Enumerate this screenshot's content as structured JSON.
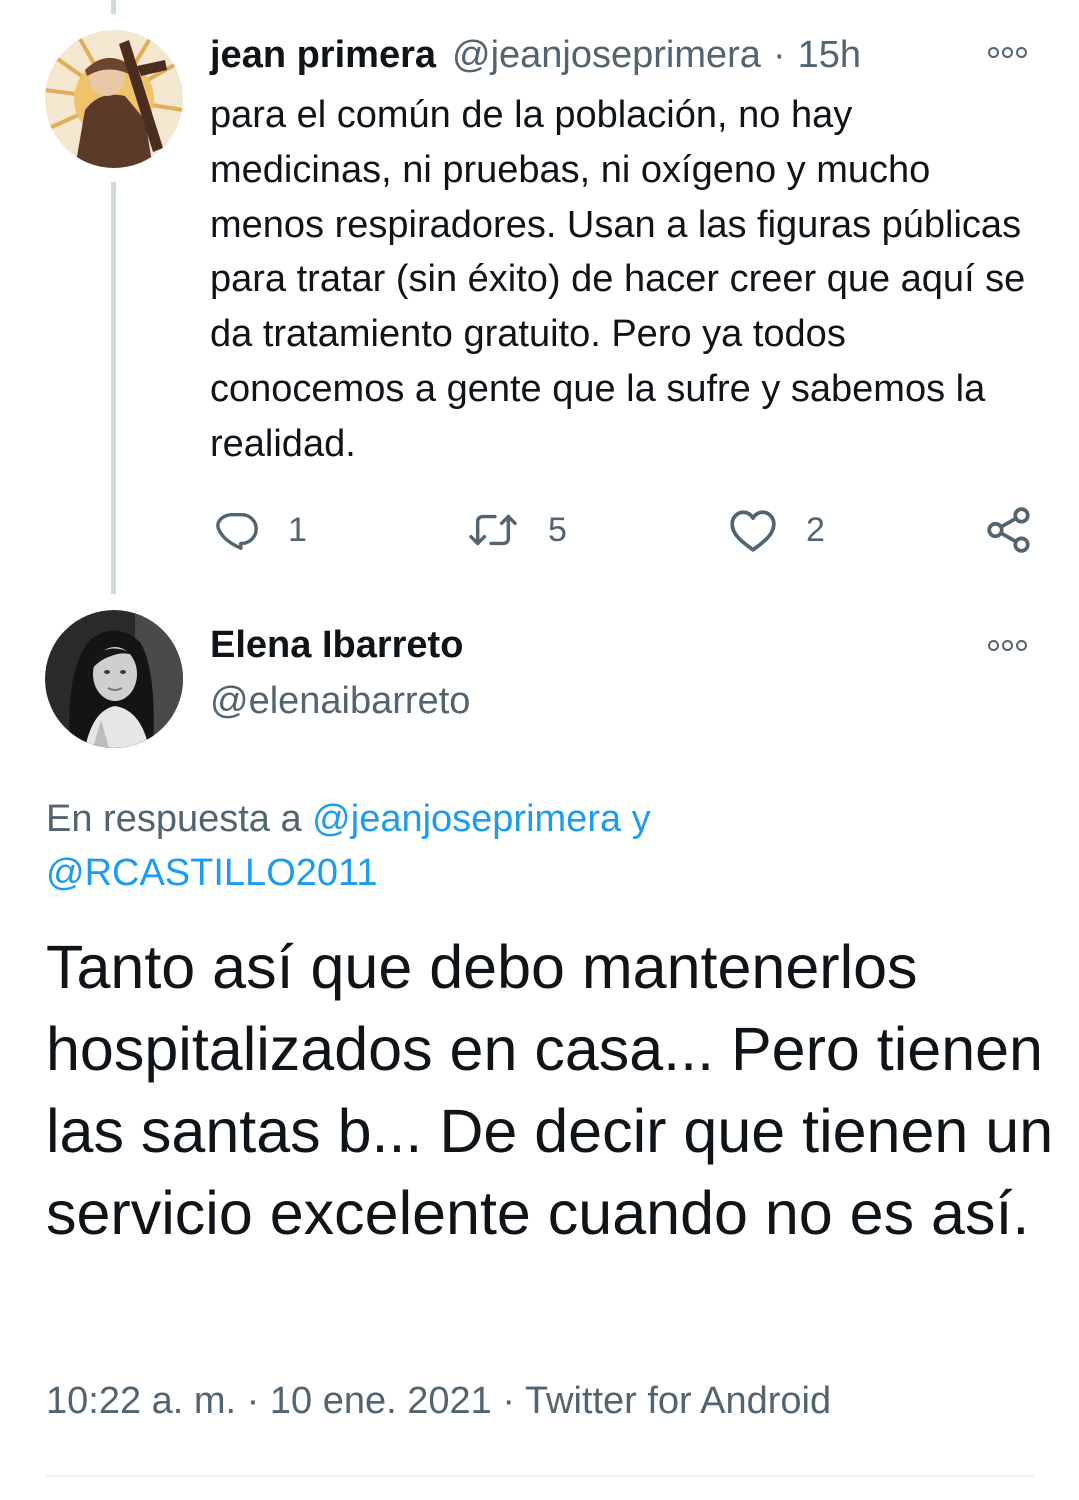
{
  "parent_tweet": {
    "display_name": "jean primera",
    "handle": "@jeanjoseprimera",
    "separator": "·",
    "time": "15h",
    "text": "para el común de la población, no hay medicinas, ni pruebas, ni oxígeno y mucho menos respiradores. Usan a las figuras públicas para tratar (sin éxito) de hacer creer que aquí se da tratamiento gratuito. Pero ya todos conocemos a gente que la sufre y sabemos la realidad.",
    "reply_count": "1",
    "retweet_count": "5",
    "like_count": "2",
    "icons": [
      "reply-icon",
      "retweet-icon",
      "like-icon",
      "share-icon",
      "more-icon"
    ]
  },
  "main_tweet": {
    "display_name": "Elena Ibarreto",
    "handle": "@elenaibarreto",
    "reply_prefix": "En respuesta a ",
    "mention_1": "@jeanjoseprimera",
    "conjunction": " y",
    "mention_2": "@RCASTILLO2011",
    "text": "Tanto así que debo mantenerlos hospitalizados en casa... Pero tienen las santas b... De decir que tienen un servicio excelente cuando no es así.",
    "time": "10:22 a. m.",
    "separator": " · ",
    "date": "10 ene. 2021",
    "source": "Twitter for Android"
  },
  "colors": {
    "text": "#0f1419",
    "secondary": "#536471",
    "link": "#1d9bf0",
    "thread_line": "#cfd9de"
  }
}
